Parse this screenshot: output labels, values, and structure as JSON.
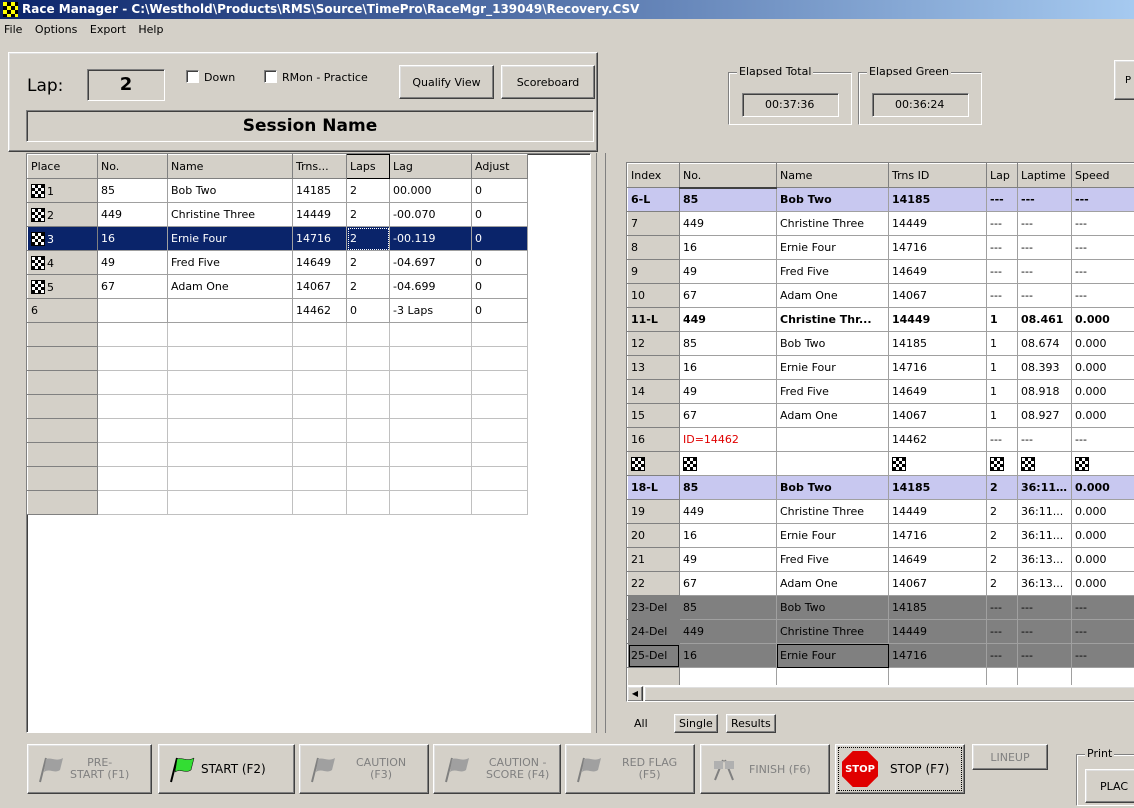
{
  "window": {
    "title": "Race Manager - C:\\Westhold\\Products\\RMS\\Source\\TimePro\\RaceMgr_139049\\Recovery.CSV"
  },
  "menu": [
    "File",
    "Options",
    "Export",
    "Help"
  ],
  "lap": {
    "label": "Lap:",
    "value": "2"
  },
  "checks": {
    "down": "Down",
    "rmon": "RMon - Practice"
  },
  "buttons": {
    "qualify": "Qualify View",
    "scoreboard": "Scoreboard"
  },
  "session": {
    "name": "Session Name"
  },
  "elapsed": {
    "total_label": "Elapsed Total",
    "total": "00:37:36",
    "green_label": "Elapsed Green",
    "green": "00:36:24",
    "cut_btn": "P N"
  },
  "standings": {
    "headers": [
      "Place",
      "No.",
      "Name",
      "Trns...",
      "Laps",
      "Lag",
      "Adjust"
    ],
    "rows": [
      [
        "1",
        "85",
        "Bob Two",
        "14185",
        "2",
        "00.000",
        "0"
      ],
      [
        "2",
        "449",
        "Christine Three",
        "14449",
        "2",
        "-00.070",
        "0"
      ],
      [
        "3",
        "16",
        "Ernie Four",
        "14716",
        "2",
        "-00.119",
        "0"
      ],
      [
        "4",
        "49",
        "Fred Five",
        "14649",
        "2",
        "-04.697",
        "0"
      ],
      [
        "5",
        "67",
        "Adam One",
        "14067",
        "2",
        "-04.699",
        "0"
      ],
      [
        "6",
        "",
        "",
        "14462",
        "0",
        "-3 Laps",
        "0"
      ]
    ]
  },
  "passings": {
    "headers": [
      "Index",
      "No.",
      "Name",
      "Trns ID",
      "Lap",
      "Laptime",
      "Speed"
    ],
    "rows": [
      [
        "6-L",
        "85",
        "Bob Two",
        "14185",
        "---",
        "---",
        "---"
      ],
      [
        "7",
        "449",
        "Christine Three",
        "14449",
        "---",
        "---",
        "---"
      ],
      [
        "8",
        "16",
        "Ernie Four",
        "14716",
        "---",
        "---",
        "---"
      ],
      [
        "9",
        "49",
        "Fred Five",
        "14649",
        "---",
        "---",
        "---"
      ],
      [
        "10",
        "67",
        "Adam One",
        "14067",
        "---",
        "---",
        "---"
      ],
      [
        "11-L",
        "449",
        "Christine Thr...",
        "14449",
        "1",
        "08.461",
        "0.000"
      ],
      [
        "12",
        "85",
        "Bob Two",
        "14185",
        "1",
        "08.674",
        "0.000"
      ],
      [
        "13",
        "16",
        "Ernie Four",
        "14716",
        "1",
        "08.393",
        "0.000"
      ],
      [
        "14",
        "49",
        "Fred Five",
        "14649",
        "1",
        "08.918",
        "0.000"
      ],
      [
        "15",
        "67",
        "Adam One",
        "14067",
        "1",
        "08.927",
        "0.000"
      ],
      [
        "16",
        "ID=14462",
        "",
        "14462",
        "---",
        "---",
        "---"
      ],
      [
        "",
        "",
        "",
        "",
        "",
        "",
        ""
      ],
      [
        "18-L",
        "85",
        "Bob Two",
        "14185",
        "2",
        "36:11...",
        "0.000"
      ],
      [
        "19",
        "449",
        "Christine Three",
        "14449",
        "2",
        "36:11...",
        "0.000"
      ],
      [
        "20",
        "16",
        "Ernie Four",
        "14716",
        "2",
        "36:11...",
        "0.000"
      ],
      [
        "21",
        "49",
        "Fred Five",
        "14649",
        "2",
        "36:13...",
        "0.000"
      ],
      [
        "22",
        "67",
        "Adam One",
        "14067",
        "2",
        "36:13...",
        "0.000"
      ],
      [
        "23-Del",
        "85",
        "Bob Two",
        "14185",
        "---",
        "---",
        "---"
      ],
      [
        "24-Del",
        "449",
        "Christine Three",
        "14449",
        "---",
        "---",
        "---"
      ],
      [
        "25-Del",
        "16",
        "Ernie Four",
        "14716",
        "---",
        "---",
        "---"
      ]
    ]
  },
  "tabs": [
    "All",
    "Single",
    "Results"
  ],
  "controls": {
    "prestart": "PRE-\nSTART (F1)",
    "start": "START (F2)",
    "caution": "CAUTION\n(F3)",
    "caution_score": "CAUTION -\nSCORE (F4)",
    "redflag": "RED FLAG\n(F5)",
    "finish": "FINISH (F6)",
    "stop": "STOP (F7)",
    "stop_sign": "STOP",
    "lineup": "LINEUP",
    "print_label": "Print",
    "print_btn": "PLAC"
  },
  "colors": {
    "selection": "#0a246a",
    "lap_leader": "#c8c8f0",
    "deleted": "#808080",
    "start_flag": "#33dd33",
    "stop": "#e00000"
  }
}
